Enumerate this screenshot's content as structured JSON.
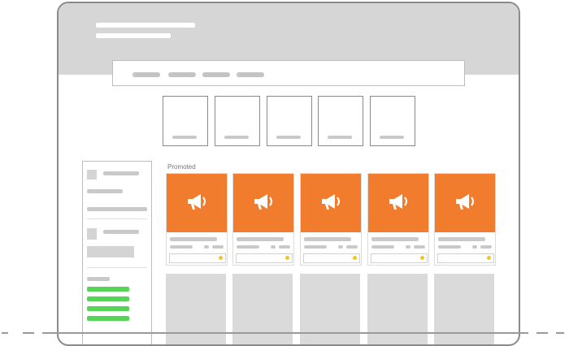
{
  "page": {
    "promoted_label": "Promoted"
  },
  "colors": {
    "header_bg": "#d6d6d6",
    "promo_orange": "#f27c2e",
    "cta_dot_yellow": "#f5c518",
    "filter_green": "#55d455",
    "placeholder_gray": "#c9c9c9"
  },
  "icons": {
    "promo_icon": "megaphone-icon"
  }
}
